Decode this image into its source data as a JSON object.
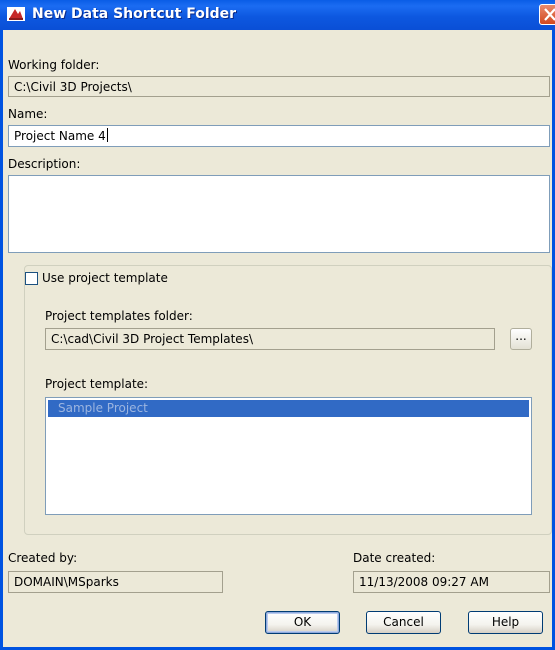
{
  "window": {
    "title": "New Data Shortcut Folder"
  },
  "working_folder": {
    "label": "Working folder:",
    "value": "C:\\Civil 3D Projects\\"
  },
  "name": {
    "label": "Name:",
    "value": "Project Name 4"
  },
  "description": {
    "label": "Description:",
    "value": ""
  },
  "use_template": {
    "label": "Use project template",
    "checked": false
  },
  "templates_folder": {
    "label": "Project templates folder:",
    "value": "C:\\cad\\Civil 3D Project Templates\\",
    "browse_label": "..."
  },
  "project_template": {
    "label": "Project template:",
    "items": [
      "Sample Project"
    ],
    "selected_index": 0
  },
  "created_by": {
    "label": "Created by:",
    "value": "DOMAIN\\MSparks"
  },
  "date_created": {
    "label": "Date created:",
    "value": "11/13/2008 09:27 AM"
  },
  "buttons": {
    "ok": "OK",
    "cancel": "Cancel",
    "help": "Help"
  },
  "colors": {
    "titlebar": "#0a5de6",
    "dialog_bg": "#ece9d8",
    "selection": "#316ac5",
    "close": "#d3481f"
  }
}
